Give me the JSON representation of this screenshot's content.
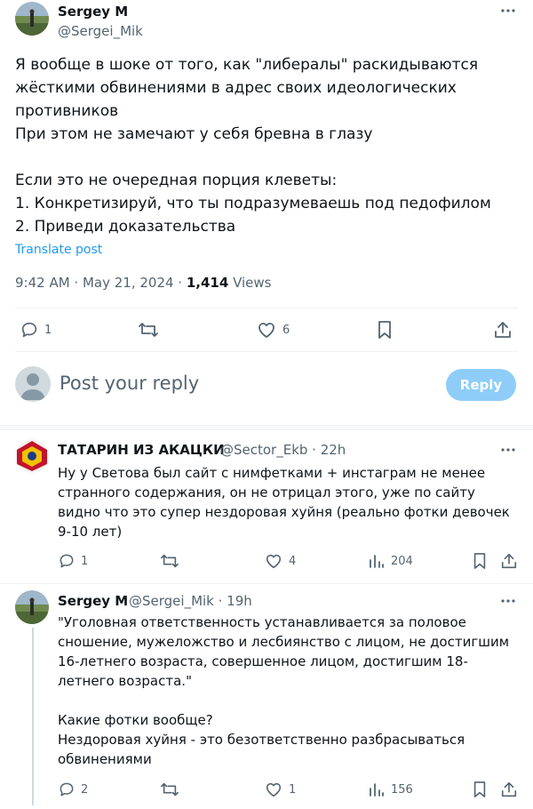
{
  "main_tweet": {
    "author_name": "Sergey M",
    "author_handle": "@Sergei_Mik",
    "text": "Я вообще в шоке от того, как \"либералы\" раскидываются жёсткими обвинениями в адрес своих идеологических противников\nПри этом не замечают у себя бревна в глазу\n\nЕсли это не очередная порция клеветы:\n1. Конкретизируй, что ты подразумеваешь под педофилом\n2. Приведи доказательства",
    "translate_label": "Translate post",
    "time": "9:42 AM · May 21, 2024 · ",
    "views_count": "1,414",
    "views_label": " Views",
    "stats": {
      "replies": "1",
      "likes": "6"
    }
  },
  "reply_box": {
    "placeholder": "Post your reply",
    "button_label": "Reply"
  },
  "replies": [
    {
      "author_name": "ТАТАРИН ИЗ АКАЦКИ",
      "author_handle": "@Sector_Ekb · 22h",
      "text": "Ну у Светова был сайт с нимфетками + инстаграм не менее странного содержания, он не отрицал этого, уже по сайту видно что это супер нездоровая хуйня (реально фотки девочек 9-10 лет)",
      "replies": "1",
      "likes": "4",
      "views": "204"
    },
    {
      "author_name": "Sergey M",
      "author_handle": "@Sergei_Mik · 19h",
      "text": "\"Уголовная ответственность устанавливается за половое сношение, мужеложство и лесбиянство с лицом, не достигшим 16-летнего возраста, совершенное лицом, достигшим 18-летнего возраста.\"\n\nКакие фотки вообще?\nНездоровая хуйня - это безответственно разбрасываться обвинениями",
      "replies": "2",
      "likes": "1",
      "views": "156"
    }
  ],
  "colors": {
    "text": "#0f1419",
    "secondary": "#536471",
    "link": "#1d9bf0",
    "reply_button": "#8ecdf8",
    "border": "#eff3f4"
  }
}
